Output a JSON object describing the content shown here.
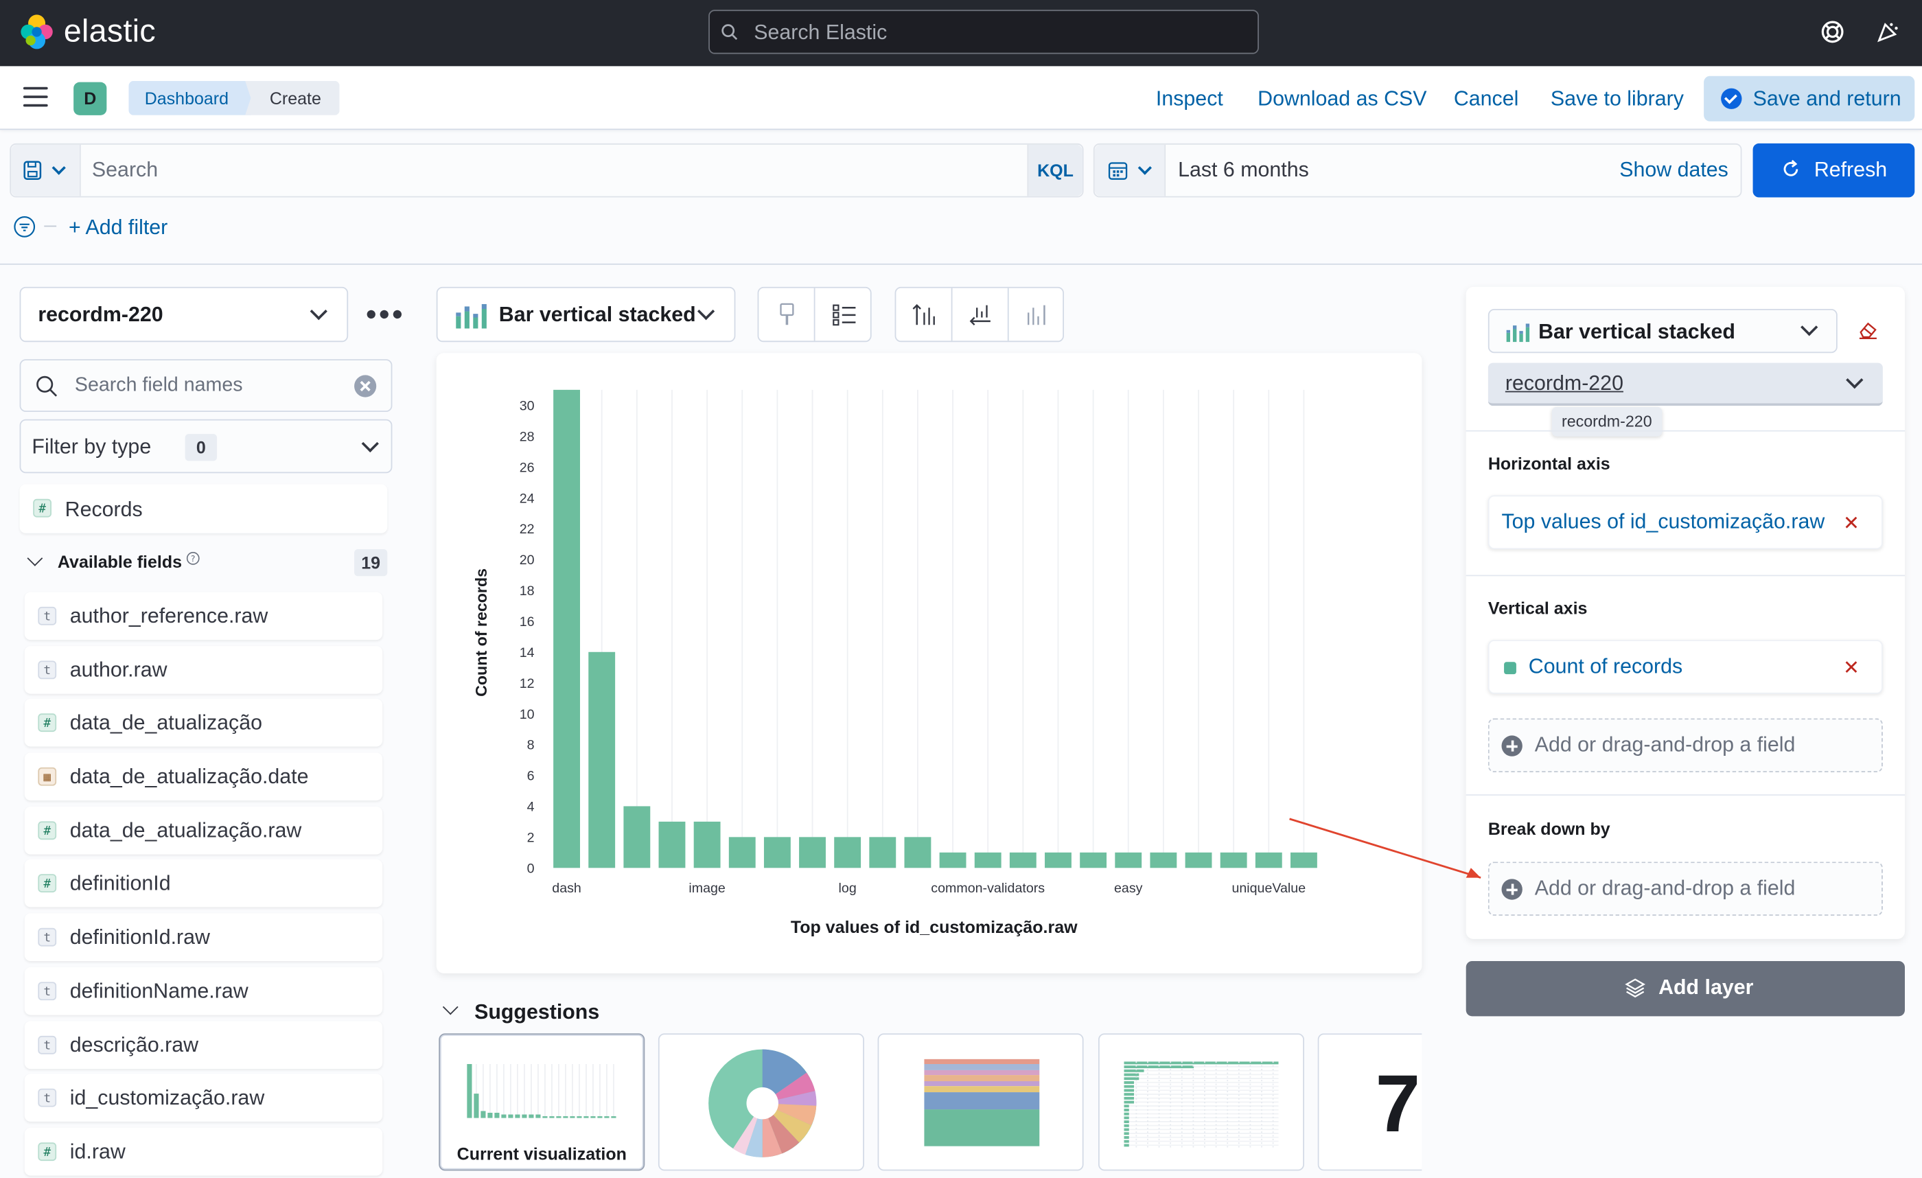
{
  "header": {
    "brand": "elastic",
    "search_placeholder": "Search Elastic"
  },
  "nav": {
    "space_letter": "D",
    "breadcrumbs": [
      "Dashboard",
      "Create"
    ],
    "links": {
      "inspect": "Inspect",
      "download_csv": "Download as CSV",
      "cancel": "Cancel",
      "save_library": "Save to library",
      "save_return": "Save and return"
    }
  },
  "query": {
    "placeholder": "Search",
    "language": "KQL",
    "time_range": "Last 6 months",
    "show_dates": "Show dates",
    "refresh": "Refresh",
    "add_filter": "+ Add filter"
  },
  "left": {
    "index_pattern": "recordm-220",
    "search_placeholder": "Search field names",
    "filter_by_type": "Filter by type",
    "filter_count": "0",
    "records_label": "Records",
    "available_label": "Available fields",
    "available_count": "19",
    "fields": [
      {
        "type": "str",
        "name": "author_reference.raw"
      },
      {
        "type": "str",
        "name": "author.raw"
      },
      {
        "type": "num",
        "name": "data_de_atualização"
      },
      {
        "type": "date",
        "name": "data_de_atualização.date"
      },
      {
        "type": "num",
        "name": "data_de_atualização.raw"
      },
      {
        "type": "num",
        "name": "definitionId"
      },
      {
        "type": "str",
        "name": "definitionId.raw"
      },
      {
        "type": "str",
        "name": "definitionName.raw"
      },
      {
        "type": "str",
        "name": "descrição.raw"
      },
      {
        "type": "str",
        "name": "id_customização.raw"
      },
      {
        "type": "num",
        "name": "id.raw"
      }
    ]
  },
  "center": {
    "vis_type": "Bar vertical stacked",
    "suggestions_label": "Suggestions",
    "suggestions": [
      {
        "caption": "Current visualization"
      },
      {
        "caption": ""
      },
      {
        "caption": ""
      },
      {
        "caption": ""
      },
      {
        "caption": "7"
      }
    ]
  },
  "chart_data": {
    "type": "bar",
    "title": "",
    "xlabel": "Top values of id_customização.raw",
    "ylabel": "Count of records",
    "ylim": [
      0,
      31
    ],
    "yticks": [
      0,
      2,
      4,
      6,
      8,
      10,
      12,
      14,
      16,
      18,
      20,
      22,
      24,
      26,
      28,
      30
    ],
    "categories": [
      "dash",
      "",
      "",
      "",
      "image",
      "",
      "",
      "",
      "log",
      "",
      "",
      "",
      "common-validators",
      "",
      "",
      "",
      "easy",
      "",
      "",
      "",
      "uniqueValue",
      ""
    ],
    "values": [
      31,
      14,
      4,
      3,
      3,
      2,
      2,
      2,
      2,
      2,
      2,
      1,
      1,
      1,
      1,
      1,
      1,
      1,
      1,
      1,
      1,
      1
    ],
    "color": "#6dbe9e",
    "grid": true
  },
  "right": {
    "vis_type": "Bar vertical stacked",
    "index_pattern": "recordm-220",
    "tooltip": "recordm-220",
    "horizontal_axis_label": "Horizontal axis",
    "horizontal_value": "Top values of id_customização.raw",
    "vertical_axis_label": "Vertical axis",
    "vertical_value": "Count of records",
    "add_field": "Add or drag-and-drop a field",
    "breakdown_label": "Break down by",
    "add_layer": "Add layer",
    "accent": "#54b399"
  }
}
